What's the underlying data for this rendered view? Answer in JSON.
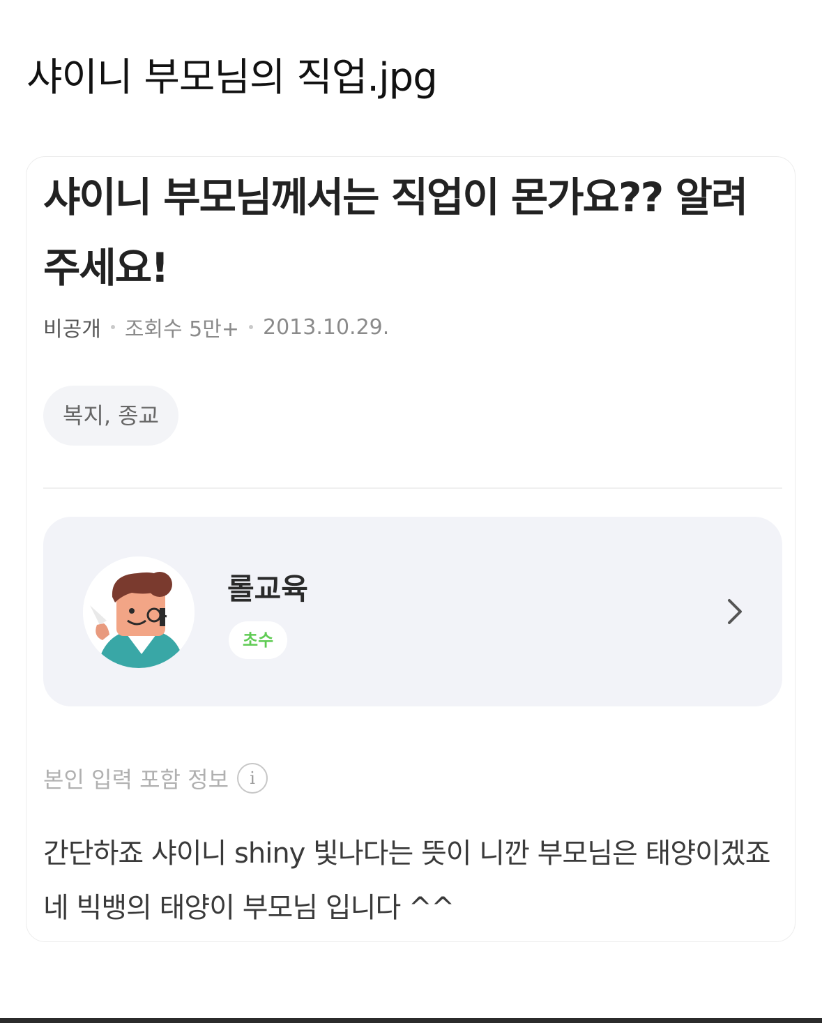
{
  "post": {
    "title": "샤이니 부모님의 직업.jpg"
  },
  "question": {
    "title": "샤이니 부모님께서는 직업이 몬가요?? 알려주세요!",
    "author": "비공개",
    "views": "조회수 5만+",
    "date": "2013.10.29.",
    "category": "복지, 종교"
  },
  "answerer": {
    "name": "롤교육",
    "level": "초수",
    "avatar_icon": "character-avatar-icon",
    "chevron_icon": "chevron-right-icon"
  },
  "answer": {
    "info_label": "본인 입력 포함 정보",
    "info_icon": "info-icon",
    "info_glyph": "i",
    "text": " 간단하죠 샤이니 shiny 빛나다는 뜻이 니깐 부모님은 태양이겠죠 네 빅뱅의 태양이 부모님 입니다 ^^"
  },
  "colors": {
    "level_badge_text": "#5fcb53",
    "profile_background": "#f2f3f8",
    "chip_background": "#f3f4f7"
  }
}
